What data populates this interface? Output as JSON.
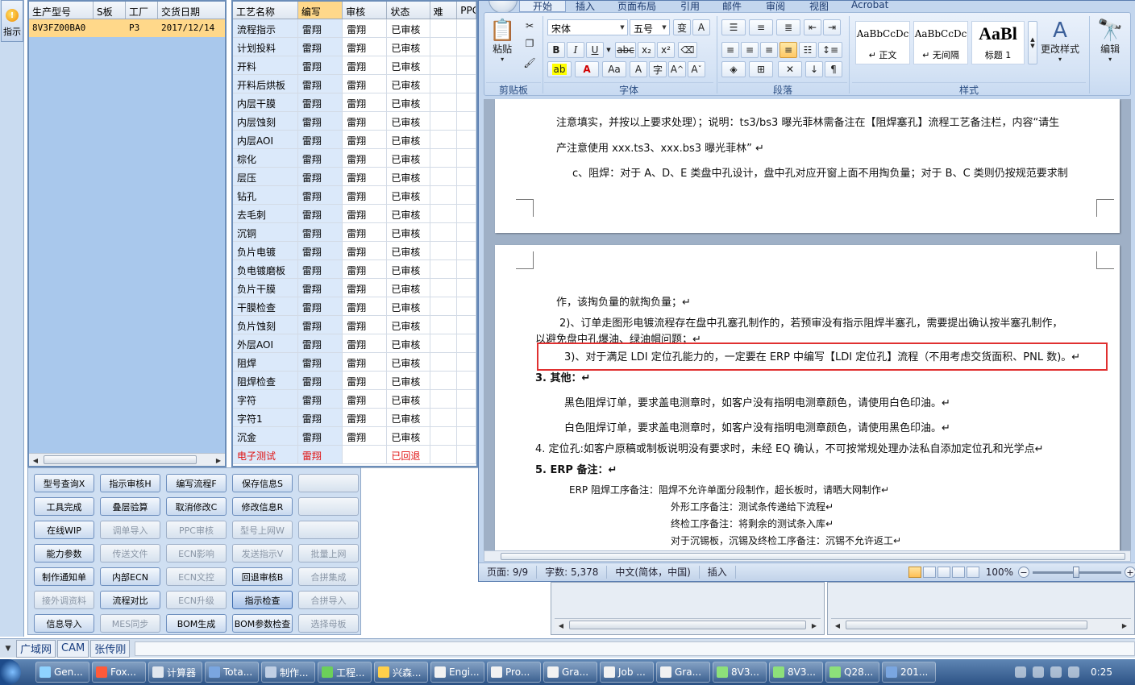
{
  "left_strip": {
    "button_label": "指示"
  },
  "model_grid": {
    "headers": [
      "生产型号",
      "S板",
      "工厂",
      "交货日期"
    ],
    "rows": [
      [
        "8V3FZ00BA0",
        "",
        "P3",
        "2017/12/14"
      ]
    ]
  },
  "process_grid": {
    "headers": [
      "工艺名称",
      "编写",
      "审核",
      "状态",
      "难",
      "PPC"
    ],
    "rows": [
      [
        "流程指示",
        "雷翔",
        "雷翔",
        "已审核"
      ],
      [
        "计划投料",
        "雷翔",
        "雷翔",
        "已审核"
      ],
      [
        "开料",
        "雷翔",
        "雷翔",
        "已审核"
      ],
      [
        "开料后烘板",
        "雷翔",
        "雷翔",
        "已审核"
      ],
      [
        "内层干膜",
        "雷翔",
        "雷翔",
        "已审核"
      ],
      [
        "内层蚀刻",
        "雷翔",
        "雷翔",
        "已审核"
      ],
      [
        "内层AOI",
        "雷翔",
        "雷翔",
        "已审核"
      ],
      [
        "棕化",
        "雷翔",
        "雷翔",
        "已审核"
      ],
      [
        "层压",
        "雷翔",
        "雷翔",
        "已审核"
      ],
      [
        "钻孔",
        "雷翔",
        "雷翔",
        "已审核"
      ],
      [
        "去毛刺",
        "雷翔",
        "雷翔",
        "已审核"
      ],
      [
        "沉铜",
        "雷翔",
        "雷翔",
        "已审核"
      ],
      [
        "负片电镀",
        "雷翔",
        "雷翔",
        "已审核"
      ],
      [
        "负电镀磨板",
        "雷翔",
        "雷翔",
        "已审核"
      ],
      [
        "负片干膜",
        "雷翔",
        "雷翔",
        "已审核"
      ],
      [
        "干膜检查",
        "雷翔",
        "雷翔",
        "已审核"
      ],
      [
        "负片蚀刻",
        "雷翔",
        "雷翔",
        "已审核"
      ],
      [
        "外层AOI",
        "雷翔",
        "雷翔",
        "已审核"
      ],
      [
        "阻焊",
        "雷翔",
        "雷翔",
        "已审核"
      ],
      [
        "阻焊检查",
        "雷翔",
        "雷翔",
        "已审核"
      ],
      [
        "字符",
        "雷翔",
        "雷翔",
        "已审核"
      ],
      [
        "字符1",
        "雷翔",
        "雷翔",
        "已审核"
      ],
      [
        "沉金",
        "雷翔",
        "雷翔",
        "已审核"
      ]
    ],
    "rejected_row": [
      "电子测试",
      "雷翔",
      "",
      "已回退"
    ]
  },
  "buttons": [
    [
      "型号查询X",
      "指示审核H",
      "编写流程F",
      "保存信息S",
      ""
    ],
    [
      "工具完成",
      "叠层验算",
      "取消修改C",
      "修改信息R",
      ""
    ],
    [
      "在线WIP",
      "调单导入",
      "PPC审核",
      "型号上网W",
      ""
    ],
    [
      "能力参数",
      "传送文件",
      "ECN影响",
      "发送指示V",
      "批量上网"
    ],
    [
      "制作通知单",
      "内部ECN",
      "ECN文控",
      "回退审核B",
      "合拼集成"
    ],
    [
      "接外调资料",
      "流程对比",
      "ECN升级",
      "指示检查",
      "合拼导入"
    ],
    [
      "信息导入",
      "MES同步",
      "BOM生成",
      "BOM参数检查",
      "选择母板"
    ]
  ],
  "disabled_buttons": [
    "调单导入",
    "PPC审核",
    "型号上网W",
    "传送文件",
    "ECN影响",
    "发送指示V",
    "批量上网",
    "ECN文控",
    "合拼集成",
    "接外调资料",
    "ECN升级",
    "合拼导入",
    "MES同步",
    "选择母板"
  ],
  "selected_button": "指示检查",
  "bottom_tabs": [
    "广域网",
    "CAM",
    "张传刚"
  ],
  "taskbar": {
    "items": [
      "Gen...",
      "Fox...",
      "计算器",
      "Tota...",
      "制作...",
      "工程...",
      "兴森...",
      "Engi...",
      "Pro...",
      "Gra...",
      "Job ...",
      "Gra...",
      "8V3...",
      "8V3...",
      "Q28...",
      "201..."
    ],
    "clock": "0:25"
  },
  "word": {
    "ribbon_tabs": [
      "开始",
      "插入",
      "页面布局",
      "引用",
      "邮件",
      "审阅",
      "视图",
      "Acrobat"
    ],
    "clipboard": {
      "paste_label": "粘贴",
      "group_label": "剪贴板"
    },
    "font": {
      "name": "宋体",
      "size": "五号",
      "group_label": "字体"
    },
    "paragraph": {
      "group_label": "段落"
    },
    "styles": {
      "items": [
        {
          "sample": "AaBbCcDc",
          "name": "↵ 正文"
        },
        {
          "sample": "AaBbCcDc",
          "name": "↵ 无间隔"
        },
        {
          "sample": "AaBl",
          "name": "标题 1"
        }
      ],
      "change_label": "更改样式",
      "group_label": "样式"
    },
    "edit_label": "编辑",
    "page_top_lines": [
      "注意填实，并按以上要求处理）；说明：ts3/bs3 曝光菲林需备注在【阻焊塞孔】流程工艺备注栏，内容“请生",
      "产注意使用 xxx.ts3、xxx.bs3 曝光菲林” ↵",
      "c、阻焊：对于 A、D、E 类盘中孔设计，盘中孔对应开窗上面不用掏负量；对于 B、C 类则仍按规范要求制"
    ],
    "page_bottom_lines": [
      "作，该掏负量的就掏负量；↵",
      "2)、订单走图形电镀流程存在盘中孔塞孔制作的，若预审没有指示阻焊半塞孔，需要提出确认按半塞孔制作，",
      "以避免盘中孔爆油、绿油帽问题；↵",
      "3)、对于满足 LDI 定位孔能力的，一定要在 ERP 中编写【LDI 定位孔】流程（不用考虑交货面积、PNL 数)。↵",
      "3. 其他：↵",
      "黑色阻焊订单，要求盖电测章时，如客户没有指明电测章颜色，请使用白色印油。↵",
      "白色阻焊订单，要求盖电测章时，如客户没有指明电测章颜色，请使用黑色印油。↵",
      "4. 定位孔:如客户原稿或制板说明没有要求时，未经 EQ 确认，不可按常规处理办法私自添加定位孔和光学点↵",
      "5. ERP 备注：↵",
      "ERP 阻焊工序备注：阻焊不允许单面分段制作，超长板时，请晒大网制作↵",
      "外形工序备注：测试条传递给下流程↵",
      "终检工序备注：将剩余的测试条入库↵",
      "对于沉锡板，沉锡及终检工序备注：沉锡不允许返工↵"
    ],
    "status": {
      "page": "页面: 9/9",
      "words": "字数: 5,378",
      "language": "中文(简体，中国)",
      "mode": "插入",
      "zoom": "100%"
    }
  },
  "colors": {
    "accent_blue": "#a9c8ec",
    "selected_row": "#ffd88a",
    "rejected_text": "#e01010",
    "highlight_box": "#e03030"
  }
}
